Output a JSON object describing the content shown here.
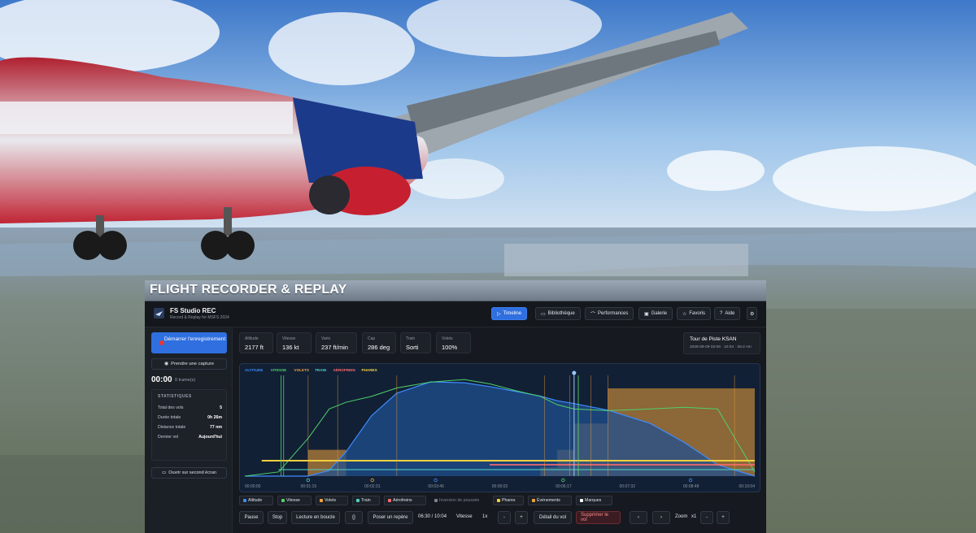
{
  "banner": {
    "title": "FLIGHT RECORDER & REPLAY"
  },
  "app": {
    "name": "FS Studio REC",
    "subtitle": "Record & Replay for MSFS 2024"
  },
  "nav": [
    {
      "label": "Timeline",
      "icon": "play-icon",
      "active": true
    },
    {
      "label": "Bibliothèque",
      "icon": "folder-icon",
      "active": false
    },
    {
      "label": "Performances",
      "icon": "chart-icon",
      "active": false
    },
    {
      "label": "Galerie",
      "icon": "image-icon",
      "active": false
    },
    {
      "label": "Favoris",
      "icon": "star-icon",
      "active": false
    },
    {
      "label": "Aide",
      "icon": "help-icon",
      "active": false
    }
  ],
  "sidebar": {
    "record_label": "Démarrer l'enregistrement",
    "capture_label": "Prendre une capture",
    "timer": "00:00",
    "frames": "0 trame(s)",
    "stats_title": "STATISTIQUES",
    "stats": [
      {
        "label": "Total des vols",
        "value": "5"
      },
      {
        "label": "Durée totale",
        "value": "0h 26m"
      },
      {
        "label": "Distance totale",
        "value": "77 nm"
      },
      {
        "label": "Dernier vol",
        "value": "Aujourd'hui"
      }
    ],
    "second_screen_label": "Ouvrir sur second écran"
  },
  "metrics": [
    {
      "label": "Altitude",
      "value": "2177 ft"
    },
    {
      "label": "Vitesse",
      "value": "136 kt"
    },
    {
      "label": "Vario",
      "value": "237 ft/min"
    },
    {
      "label": "Cap",
      "value": "286 deg"
    },
    {
      "label": "Train",
      "value": "Sorti"
    },
    {
      "label": "Volets",
      "value": "100%"
    }
  ],
  "flight": {
    "title": "Tour de Piste KSAN",
    "meta": "2026-08-09 02:06 · 10:04 · 28.2 nm"
  },
  "chart_data": {
    "type": "line",
    "legend": [
      "ALTITUDE",
      "VITESSE",
      "VOLETS",
      "TRAIN",
      "AÉROFREIN",
      "PHARES"
    ],
    "legend_colors": [
      "#3d8bff",
      "#4fd16b",
      "#f0a23b",
      "#4fd1c5",
      "#ff6b6b",
      "#f0d040"
    ],
    "x_ticks": [
      "00:00:00",
      "00:01:15",
      "00:02:31",
      "00:03:46",
      "00:05:02",
      "00:06:17",
      "00:07:32",
      "00:08:48",
      "00:10:04"
    ],
    "x_seconds": [
      0,
      40,
      75,
      100,
      120,
      150,
      180,
      220,
      260,
      290,
      320,
      350,
      370,
      390,
      430,
      480,
      520,
      560,
      604
    ],
    "series": [
      {
        "name": "ALTITUDE",
        "values": [
          0,
          0,
          0,
          60,
          260,
          640,
          880,
          1000,
          990,
          950,
          900,
          850,
          800,
          770,
          700,
          560,
          360,
          120,
          0
        ],
        "color": "#3d8bff"
      },
      {
        "name": "VITESSE",
        "values": [
          0,
          5,
          45,
          80,
          88,
          95,
          105,
          112,
          115,
          110,
          102,
          95,
          85,
          80,
          78,
          80,
          82,
          80,
          5
        ],
        "color": "#4fd16b"
      },
      {
        "name": "VOLETS",
        "values": [
          0,
          0,
          30,
          30,
          0,
          0,
          0,
          0,
          0,
          0,
          0,
          10,
          30,
          60,
          100,
          100,
          100,
          100,
          100
        ],
        "color": "#f0a23b"
      }
    ],
    "bottom_markers": [
      {
        "x": "00:01:15",
        "color": "#4fd1c5"
      },
      {
        "x": "00:02:31",
        "color": "#f0a23b"
      },
      {
        "x": "00:03:46",
        "color": "#3d8bff"
      },
      {
        "x": "00:06:17",
        "color": "#4fd16b"
      },
      {
        "x": "00:08:48",
        "color": "#3d8bff"
      }
    ],
    "playhead": "00:06:30",
    "grid": false
  },
  "layers": [
    {
      "label": "Altitude",
      "color": "#3d8bff",
      "on": true
    },
    {
      "label": "Vitesse",
      "color": "#4fd16b",
      "on": true
    },
    {
      "label": "Volets",
      "color": "#f0a23b",
      "on": true
    },
    {
      "label": "Train",
      "color": "#4fd1c5",
      "on": true
    },
    {
      "label": "Aérofreins",
      "color": "#ff6b6b",
      "on": true
    },
    {
      "label": "Inversion de poussée",
      "color": "#7b8390",
      "on": false
    },
    {
      "label": "Phares",
      "color": "#f0d040",
      "on": true
    },
    {
      "label": "Événements",
      "color": "#f0a23b",
      "on": true
    },
    {
      "label": "Marques",
      "color": "#ffffff",
      "on": true
    }
  ],
  "controls": {
    "pause": "Pause",
    "stop": "Stop",
    "loop": "Lecture en boucle",
    "braces": "{}",
    "bookmark": "Poser un repère",
    "time": "06:30 / 10:04",
    "speed_label": "Vitesse",
    "speed_value": "1x",
    "minus": "-",
    "plus": "+",
    "detail": "Détail du vol",
    "delete": "Supprimer le vol",
    "prev": "‹",
    "next": "›",
    "zoom_label": "Zoom",
    "zoom_value": "x1"
  }
}
